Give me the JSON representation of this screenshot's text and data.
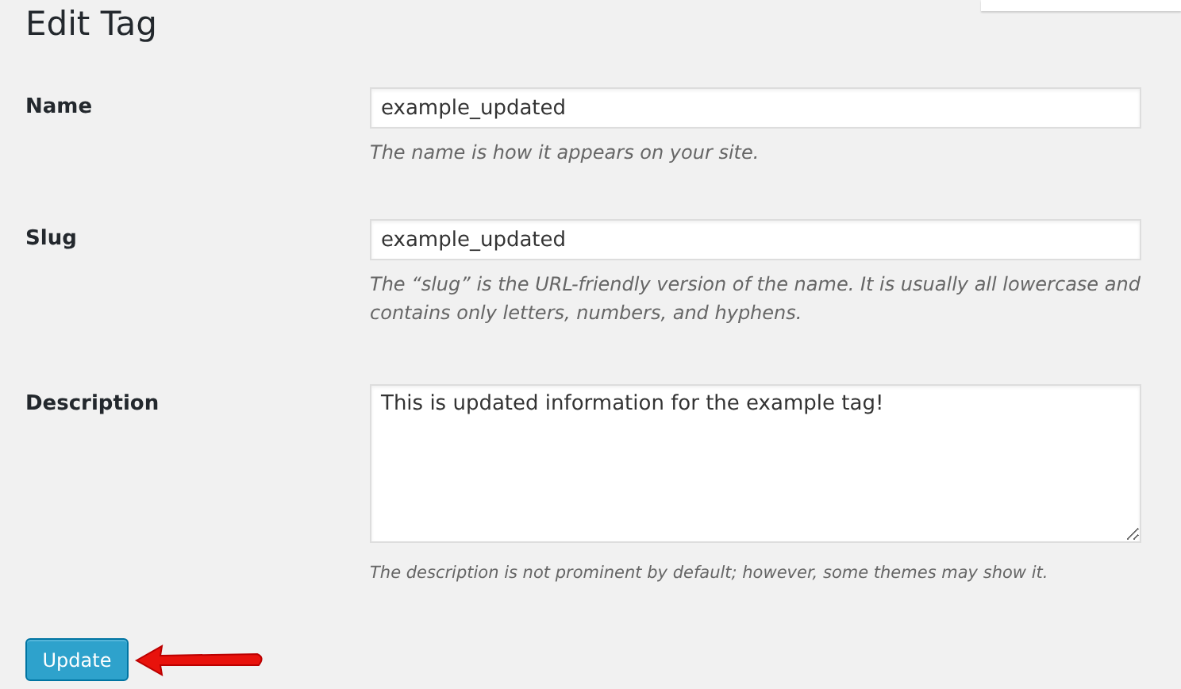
{
  "page": {
    "title": "Edit Tag"
  },
  "fields": [
    {
      "kind": "input",
      "label": "Name",
      "value": "example_updated",
      "help": "The name is how it appears on your site."
    },
    {
      "kind": "input",
      "label": "Slug",
      "value": "example_updated",
      "help": "The “slug” is the URL-friendly version of the name. It is usually all lowercase and contains only letters, numbers, and hyphens."
    },
    {
      "kind": "textarea",
      "label": "Description",
      "value": "This is updated information for the example tag!",
      "help": "The description is not prominent by default; however, some themes may show it."
    }
  ],
  "buttons": [
    {
      "label": "Update"
    }
  ]
}
